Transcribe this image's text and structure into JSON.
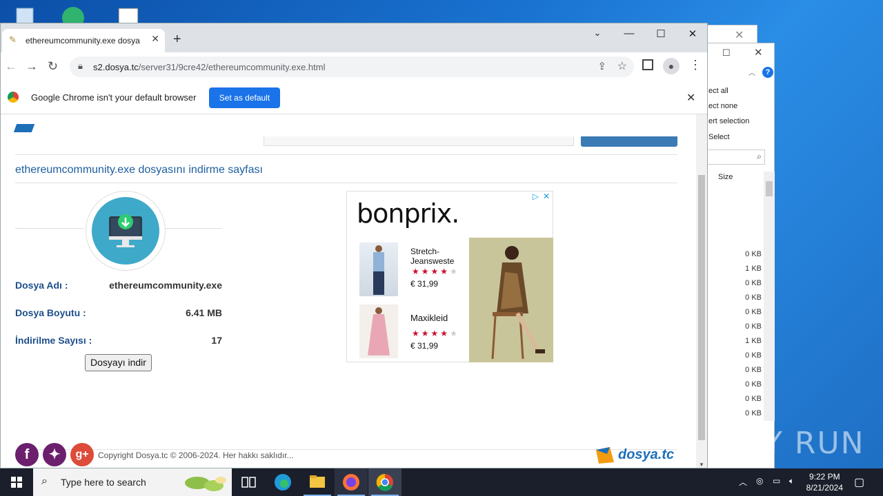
{
  "browser": {
    "tab_title": "ethereumcommunity.exe dosya",
    "url_host": "s2.dosya.tc",
    "url_path": "/server31/9cre42/ethereumcommunity.exe.html",
    "infobar_text": "Google Chrome isn't your default browser",
    "infobar_button": "Set as default"
  },
  "page": {
    "title": "ethereumcommunity.exe dosyasını indirme sayfası",
    "fields": [
      {
        "label": "Dosya Adı :",
        "value": "ethereumcommunity.exe"
      },
      {
        "label": "Dosya Boyutu :",
        "value": "6.41 MB"
      },
      {
        "label": "İndirilme Sayısı :",
        "value": "17"
      }
    ],
    "download_button": "Dosyayı indir",
    "copyright": "Copyright Dosya.tc © 2006-2024. Her hakkı saklıdır...",
    "footer_logo": "dosya.tc"
  },
  "ad": {
    "brand": "bonprix.",
    "items": [
      {
        "name_line1": "Stretch-",
        "name_line2": "Jeansweste",
        "price": "€ 31,99",
        "stars": 4
      },
      {
        "name_line1": "Maxikleid",
        "name_line2": "",
        "price": "€ 31,99",
        "stars": 4
      }
    ]
  },
  "explorer": {
    "menu": [
      "ect all",
      "ect none",
      "ert selection",
      "Select"
    ],
    "column_header": "Size",
    "sizes": [
      "0 KB",
      "1 KB",
      "0 KB",
      "0 KB",
      "0 KB",
      "0 KB",
      "1 KB",
      "0 KB",
      "0 KB",
      "0 KB",
      "0 KB",
      "0 KB"
    ]
  },
  "taskbar": {
    "search_placeholder": "Type here to search",
    "time": "9:22 PM",
    "date": "8/21/2024"
  },
  "watermark": "ANY RUN",
  "colors": {
    "accent": "#1a73e8",
    "site_blue": "#1d5e9e",
    "star": "#c8102e",
    "taskbar": "#1a1f2b"
  }
}
